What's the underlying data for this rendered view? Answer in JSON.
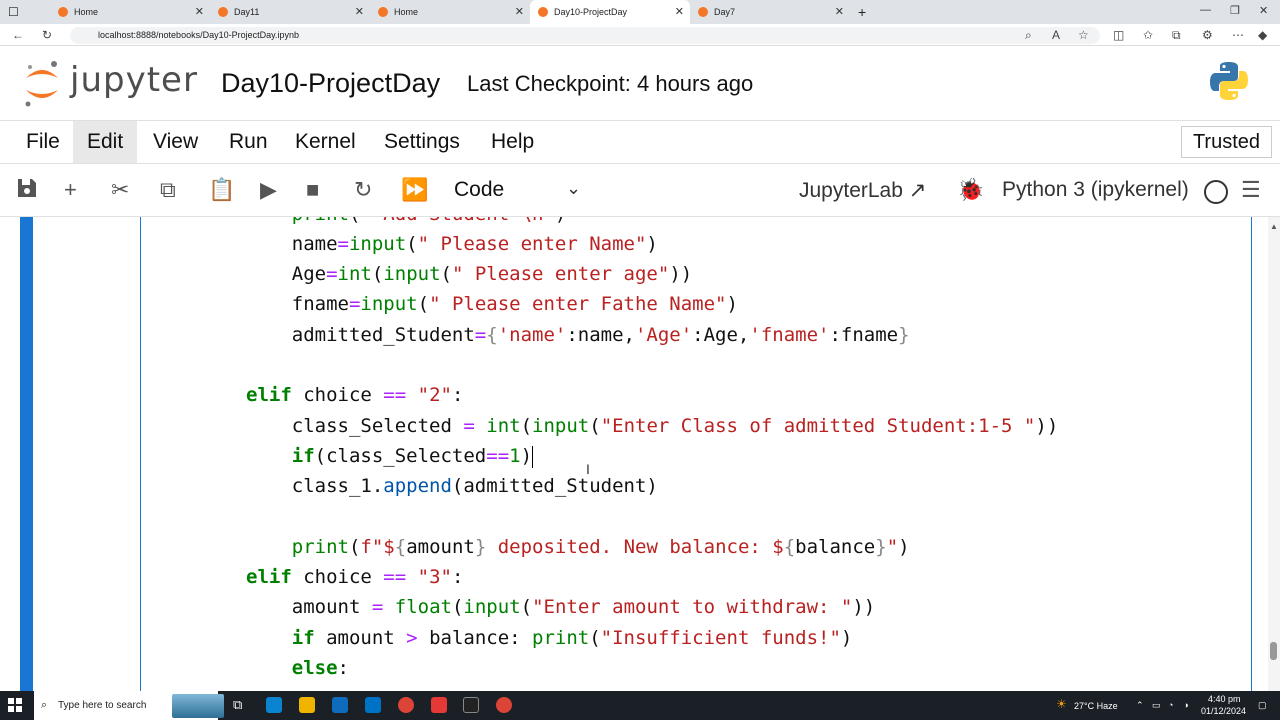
{
  "browser": {
    "tabs": [
      {
        "label": "Home",
        "color": "#f37726"
      },
      {
        "label": "Day11",
        "color": "#f37726"
      },
      {
        "label": "Home",
        "color": "#f37726"
      },
      {
        "label": "Day10-ProjectDay",
        "color": "#f37726"
      },
      {
        "label": "Day7",
        "color": "#f37726"
      }
    ],
    "url": "localhost:8888/notebooks/Day10-ProjectDay.ipynb"
  },
  "header": {
    "logo_text": "jupyter",
    "notebook_title": "Day10-ProjectDay",
    "checkpoint": "Last Checkpoint: 4 hours ago"
  },
  "menu": {
    "items": [
      "File",
      "Edit",
      "View",
      "Run",
      "Kernel",
      "Settings",
      "Help"
    ],
    "active": "Edit",
    "trusted": "Trusted"
  },
  "toolbar": {
    "cell_type": "Code",
    "jupyterlab_link": "JupyterLab",
    "kernel_name": "Python 3 (ipykernel)"
  },
  "code": {
    "language": "python",
    "lines": [
      "    print(\" Add Student \\n\")",
      "    name=input(\" Please enter Name\")",
      "    Age=int(input(\" Please enter age\"))",
      "    fname=input(\" Please enter Fathe Name\")",
      "    admitted_Student={'name':name,'Age':Age,'fname':fname}",
      "",
      "elif choice == \"2\":",
      "    class_Selected = int(input(\"Enter Class of admitted Student:1-5 \"))",
      "    if(class_Selected==1)",
      "    class_1.append(admitted_Student)",
      "",
      "    print(f\"${amount} deposited. New balance: ${balance}\")",
      "elif choice == \"3\":",
      "    amount = float(input(\"Enter amount to withdraw: \"))",
      "    if amount > balance: print(\"Insufficient funds!\")",
      "    else:"
    ]
  },
  "taskbar": {
    "search_placeholder": "Type here to search",
    "weather": "27°C Haze",
    "time": "4:40 pm",
    "date": "01/12/2024"
  }
}
